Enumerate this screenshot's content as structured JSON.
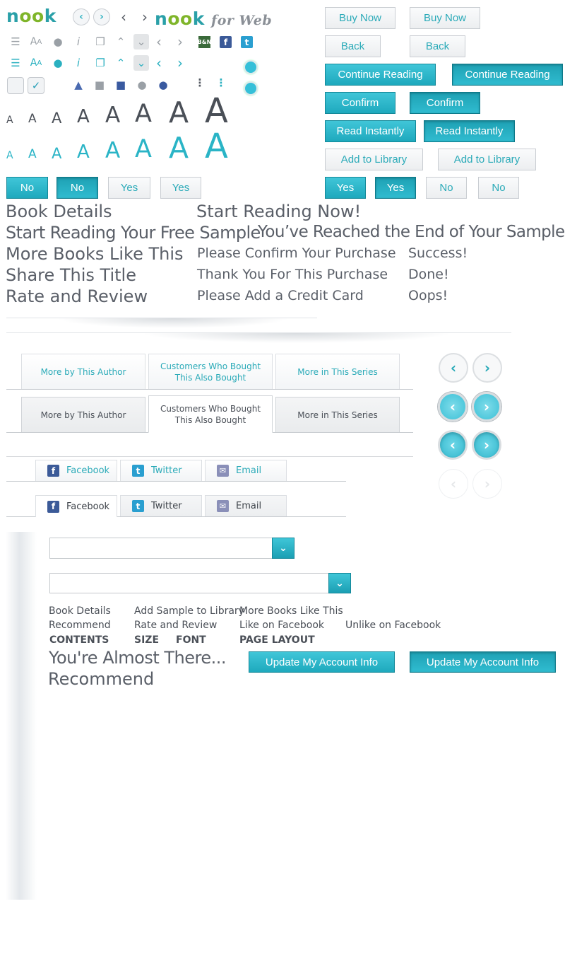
{
  "logos": {
    "nook1": [
      "n",
      "o",
      "o",
      "k"
    ],
    "nook2": [
      "n",
      "o",
      "o",
      "k"
    ],
    "for_web": "for Web",
    "bn": "B&N"
  },
  "colors": {
    "teal": "#2aaab8",
    "teal_dark": "#148898",
    "text_grey": "#5a5f68",
    "facebook": "#3b5a98",
    "twitter": "#2a9fd0"
  },
  "icons_row1": [
    "list-icon",
    "font-size-icon",
    "people-icon",
    "info-icon",
    "copy-icon",
    "double-up-icon",
    "double-down-icon",
    "chevron-left-icon",
    "chevron-right-icon",
    "bn-icon",
    "facebook-icon",
    "twitter-icon"
  ],
  "icons_row3": [
    "thumbs-up-icon",
    "speech-bubbles-icon",
    "speech-bubbles-blue-icon",
    "people-grey-icon",
    "people-blue-icon",
    "dots-icon",
    "dots-teal-icon"
  ],
  "font_letter": "A",
  "right_buttons": {
    "buy_now": "Buy Now",
    "back": "Back",
    "continue_reading": "Continue Reading",
    "confirm": "Confirm",
    "read_instantly": "Read Instantly",
    "add_to_library": "Add to Library",
    "yes": "Yes",
    "no": "No"
  },
  "left_buttons": {
    "no": "No",
    "yes": "Yes"
  },
  "headings": {
    "book_details": "Book Details",
    "start_reading_now": "Start Reading Now!",
    "start_reading_sample": "Start Reading Your Free Sample",
    "end_of_sample": "You’ve Reached the End of Your Sample",
    "more_books": "More Books Like This",
    "confirm_purchase": "Please Confirm Your Purchase",
    "success": "Success!",
    "share_title": "Share This Title",
    "thank_you": "Thank You For This Purchase",
    "done": "Done!",
    "rate_review": "Rate and Review",
    "add_credit_card": "Please Add a Credit Card",
    "oops": "Oops!"
  },
  "tabs": {
    "more_by_author": "More by This Author",
    "customers_bought_1": "Customers Who Bought",
    "customers_bought_2": "This Also Bought",
    "more_in_series": "More in This Series"
  },
  "share": {
    "facebook": "Facebook",
    "twitter": "Twitter",
    "email": "Email"
  },
  "select1": {
    "value": ""
  },
  "select2": {
    "value": ""
  },
  "links": {
    "book_details": "Book Details",
    "add_sample": "Add Sample to Library",
    "more_books": "More Books Like This",
    "recommend": "Recommend",
    "rate_review": "Rate and Review",
    "like_fb": "Like on Facebook",
    "unlike_fb": "Unlike on Facebook"
  },
  "reader_menu": {
    "contents": "CONTENTS",
    "size": "SIZE",
    "font": "FONT",
    "layout": "PAGE LAYOUT"
  },
  "almost_there": "You're Almost There...",
  "recommend_big": "Recommend",
  "update_account": "Update My Account Info"
}
